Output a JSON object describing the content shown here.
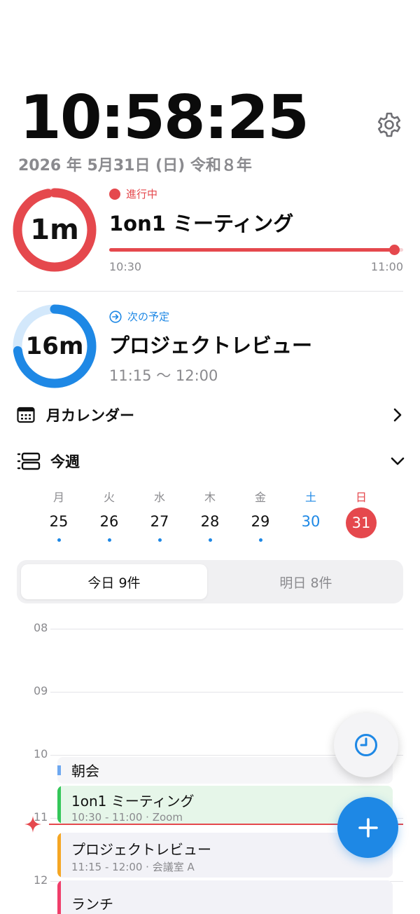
{
  "clock": {
    "time": "10:58:25"
  },
  "date_line": "2026 年 5月31日 (日)  令和８年",
  "current_event": {
    "status": "進行中",
    "remaining": "1m",
    "title": "1on1 ミーティング",
    "start": "10:30",
    "end": "11:00",
    "progress": 0.97,
    "ring_progress": 0.97,
    "color": "#e5484d"
  },
  "next_event": {
    "status": "次の予定",
    "until": "16m",
    "title": "プロジェクトレビュー",
    "time_range": "11:15 〜 12:00",
    "ring_progress": 0.73,
    "color": "#1e88e5"
  },
  "month_calendar": {
    "label": "月カレンダー",
    "icon": "calendar-icon"
  },
  "this_week": {
    "label": "今週",
    "icon": "list-icon",
    "days": [
      {
        "dow": "月",
        "date": "25",
        "has_events": true,
        "kind": "weekday"
      },
      {
        "dow": "火",
        "date": "26",
        "has_events": true,
        "kind": "weekday"
      },
      {
        "dow": "水",
        "date": "27",
        "has_events": true,
        "kind": "weekday"
      },
      {
        "dow": "木",
        "date": "28",
        "has_events": true,
        "kind": "weekday"
      },
      {
        "dow": "金",
        "date": "29",
        "has_events": true,
        "kind": "weekday"
      },
      {
        "dow": "土",
        "date": "30",
        "has_events": false,
        "kind": "saturday"
      },
      {
        "dow": "日",
        "date": "31",
        "has_events": false,
        "kind": "today"
      }
    ]
  },
  "segment": {
    "today_label": "今日 9件",
    "tomorrow_label": "明日 8件",
    "selected": "today"
  },
  "timeline": {
    "hours": [
      "08",
      "09",
      "10",
      "11",
      "12"
    ],
    "events": [
      {
        "title": "朝会",
        "subtitle": "",
        "color": "#6ea8f0"
      },
      {
        "title": "1on1 ミーティング",
        "subtitle": "10:30 - 11:00 · Zoom",
        "color": "#34c759"
      },
      {
        "title": "プロジェクトレビュー",
        "subtitle": "11:15 - 12:00 · 会議室 A",
        "color": "#f5a623"
      },
      {
        "title": "ランチ",
        "subtitle": "",
        "color": "#f03e6a"
      }
    ]
  },
  "colors": {
    "accent_blue": "#1e88e5",
    "accent_red": "#e5484d",
    "muted": "#8a8a8e"
  }
}
